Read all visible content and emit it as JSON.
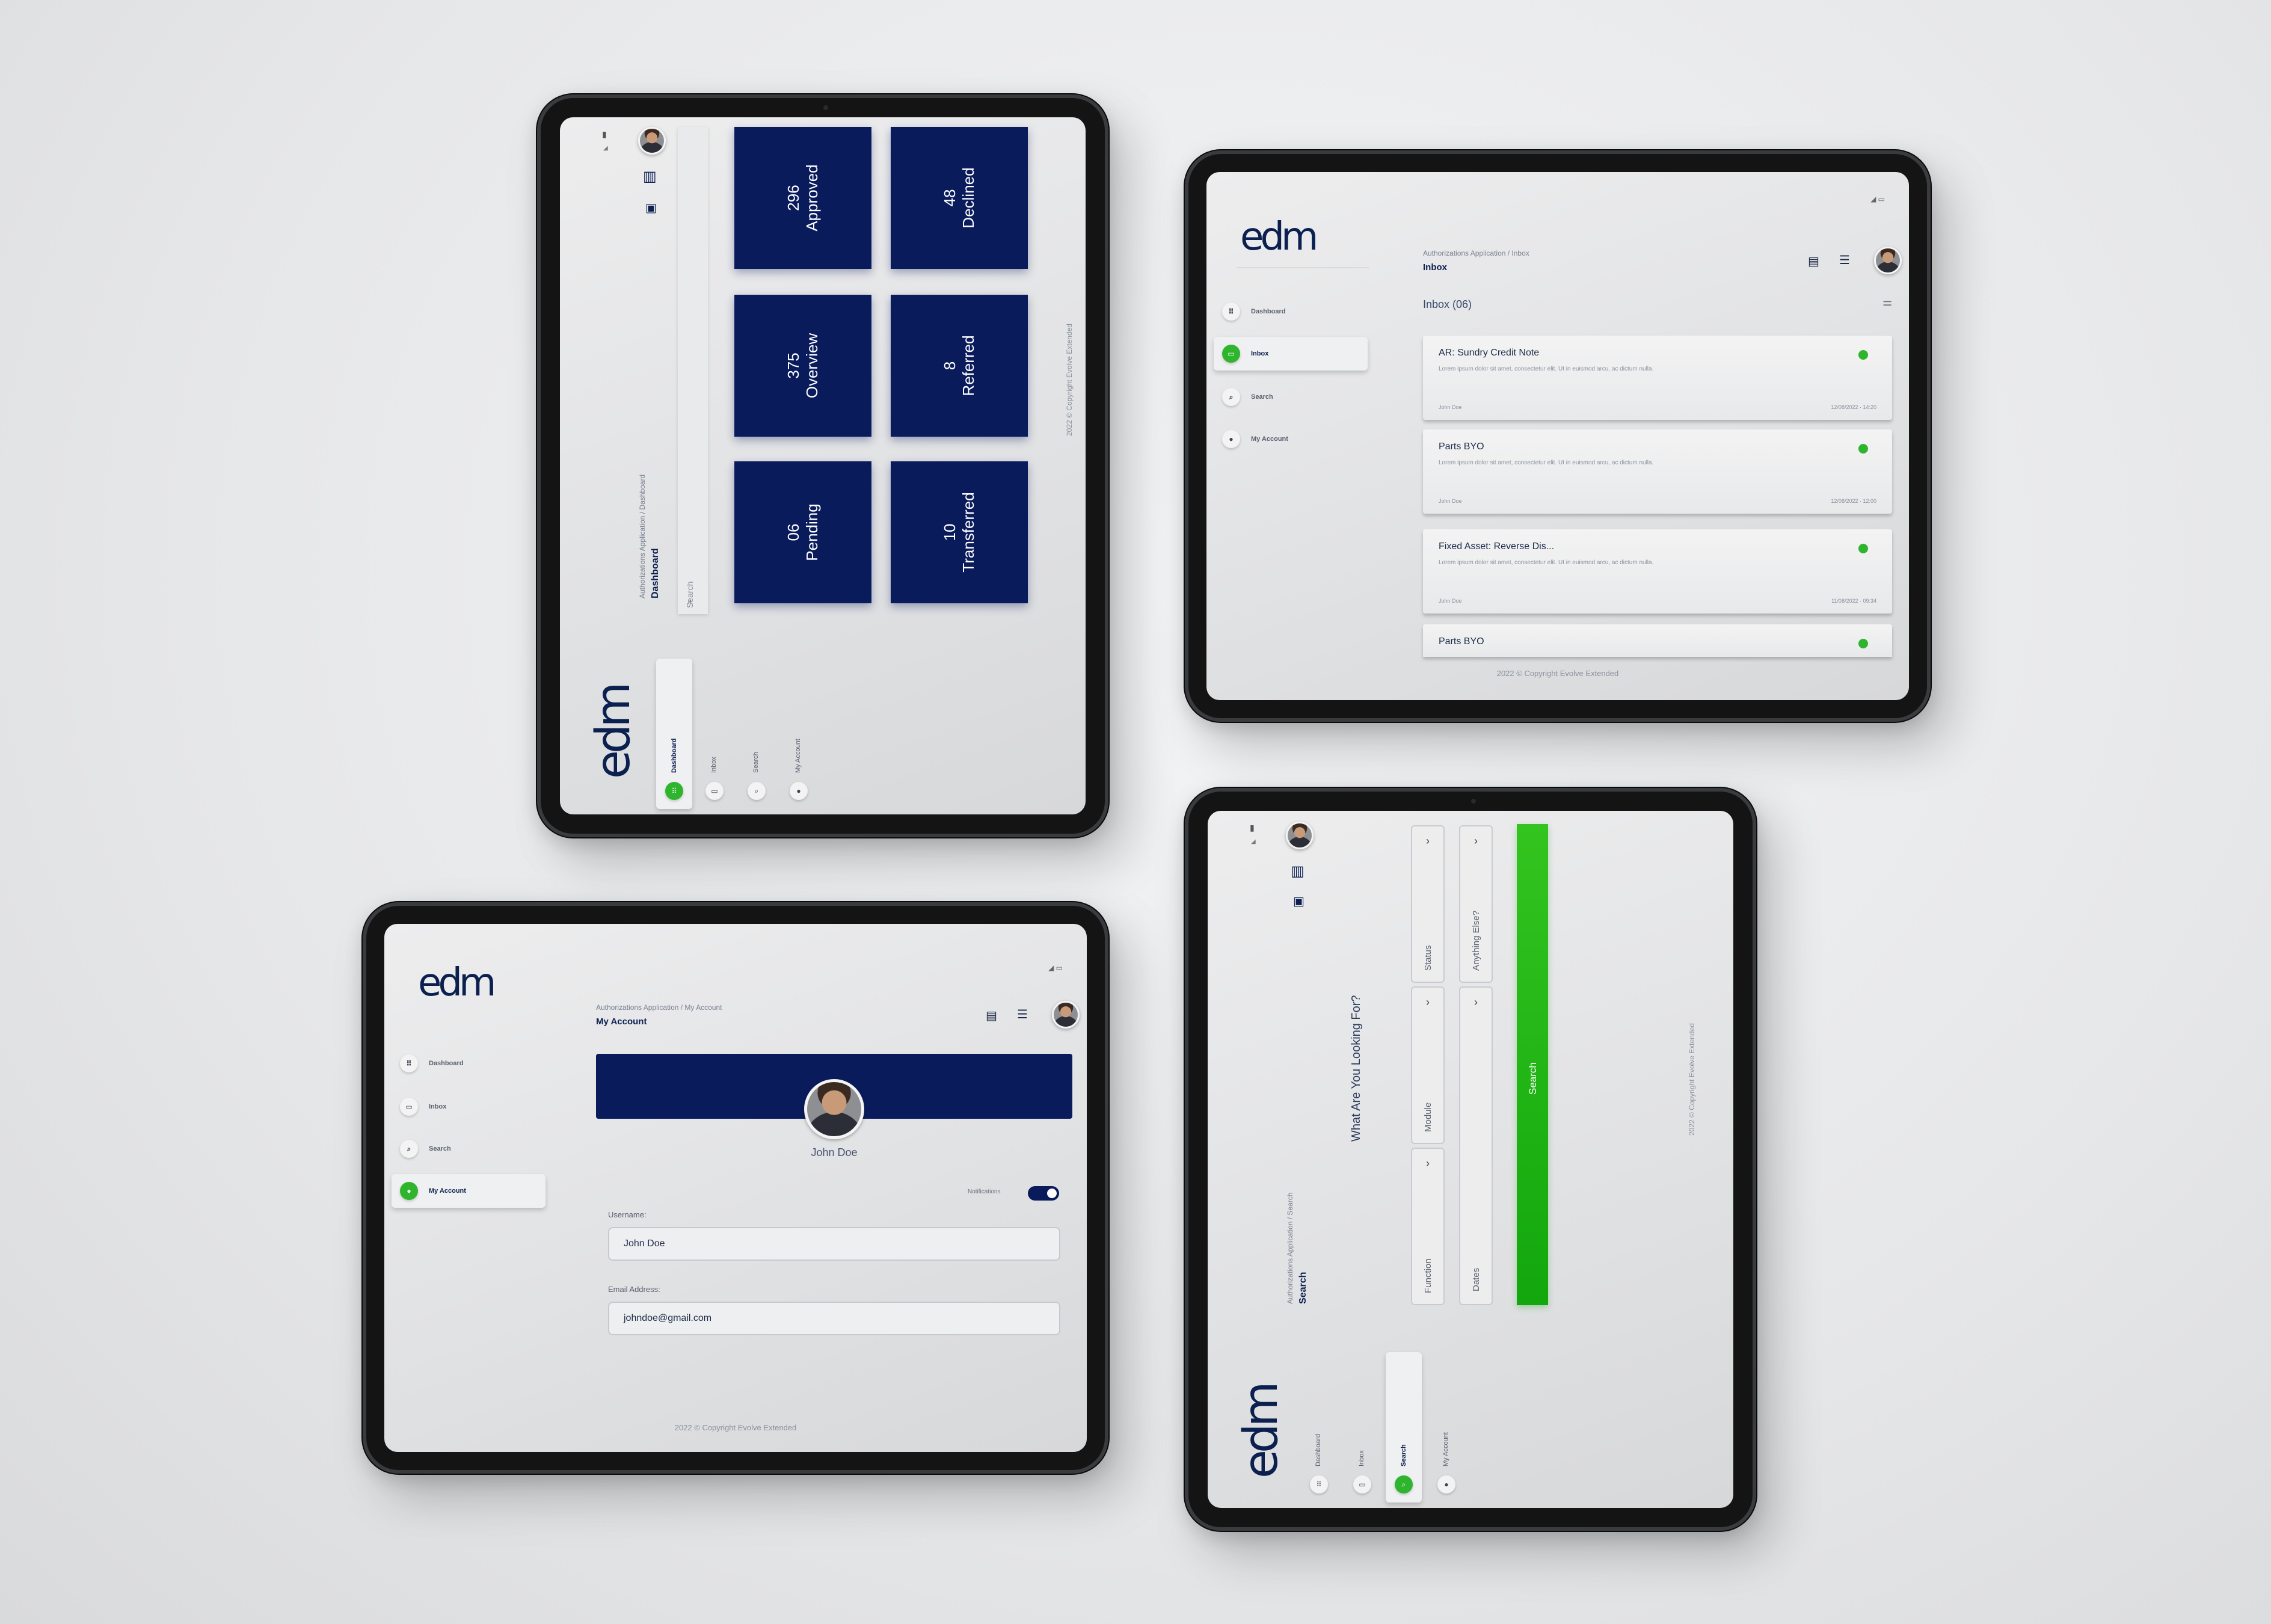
{
  "brand": {
    "logo": "edm",
    "navy": "#0a1b5c",
    "green": "#2fb52d"
  },
  "footer": "2022 © Copyright Evolve Extended",
  "nav": {
    "dashboard": "Dashboard",
    "inbox": "Inbox",
    "search": "Search",
    "account": "My Account"
  },
  "dashboard": {
    "breadcrumb": "Authorizations Application / Dashboard",
    "title": "Dashboard",
    "search_placeholder": "Search",
    "tiles": [
      {
        "num": "296",
        "label": "Approved"
      },
      {
        "num": "48",
        "label": "Declined"
      },
      {
        "num": "375",
        "label": "Overview"
      },
      {
        "num": "8",
        "label": "Referred"
      },
      {
        "num": "06",
        "label": "Pending"
      },
      {
        "num": "10",
        "label": "Transferred"
      }
    ]
  },
  "inbox": {
    "breadcrumb": "Authorizations Application / Inbox",
    "title": "Inbox",
    "count_label": "Inbox (06)",
    "messages": [
      {
        "title": "AR: Sundry Credit Note",
        "body": "Lorem ipsum dolor sit amet, consectetur elit. Ut in euismod arcu, ac dictum nulla.",
        "author": "John Doe",
        "date": "12/08/2022 · 14:20"
      },
      {
        "title": "Parts BYO",
        "body": "Lorem ipsum dolor sit amet, consectetur elit. Ut in euismod arcu, ac dictum nulla.",
        "author": "John Doe",
        "date": "12/08/2022 · 12:00"
      },
      {
        "title": "Fixed Asset: Reverse Dis...",
        "body": "Lorem ipsum dolor sit amet, consectetur elit. Ut in euismod arcu, ac dictum nulla.",
        "author": "John Doe",
        "date": "11/08/2022 · 09:34"
      },
      {
        "title": "Parts BYO",
        "body": "",
        "author": "",
        "date": ""
      }
    ]
  },
  "account": {
    "breadcrumb": "Authorizations Application / My Account",
    "title": "My Account",
    "name": "John Doe",
    "notifications_label": "Notifications",
    "username_label": "Username:",
    "username_value": "John Doe",
    "email_label": "Email Address:",
    "email_value": "johndoe@gmail.com"
  },
  "search": {
    "breadcrumb": "Authorizations Application / Search",
    "title": "Search",
    "heading": "What Are You Looking For?",
    "filters_left": [
      "Status",
      "Module",
      "Function"
    ],
    "filters_right": [
      "Anything Else?",
      "Dates"
    ],
    "button": "Search"
  }
}
